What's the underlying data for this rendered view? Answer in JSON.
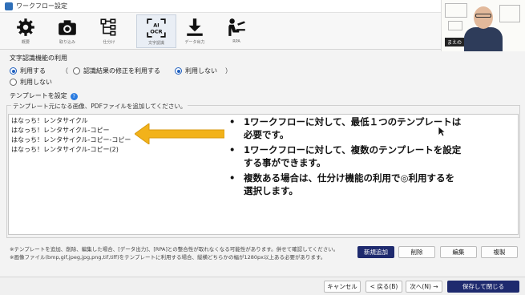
{
  "window": {
    "title": "ワークフロー設定"
  },
  "toolbar": {
    "items": [
      {
        "label": "概要",
        "icon": "gear-icon"
      },
      {
        "label": "取り込み",
        "icon": "camera-icon"
      },
      {
        "label": "仕分け",
        "icon": "sort-tree-icon"
      },
      {
        "label": "文字認識",
        "icon": "ai-ocr-icon",
        "active": true
      },
      {
        "label": "データ出力",
        "icon": "download-icon"
      },
      {
        "label": "RPA",
        "icon": "person-desk-icon"
      }
    ],
    "ocr_line1": "AI",
    "ocr_line2": "OCR"
  },
  "webcam": {
    "name_tag": "まえの"
  },
  "ocr_feature": {
    "title": "文字認識機能の利用",
    "use": "利用する",
    "paren_open": "（",
    "correction_use": "認識結果の修正を利用する",
    "correction_nouse": "利用しない",
    "paren_close": "）",
    "nouse": "利用しない"
  },
  "template": {
    "title": "テンプレートを設定",
    "help": "?",
    "group_caption": "テンプレート元になる画像、PDFファイルを追加してください。",
    "items": [
      "はなっち！レンタサイクル",
      "はなっち！レンタサイクル-コピー",
      "はなっち！レンタサイクル-コピー-コピー",
      "はなっち！レンタサイクル-コピー(2)"
    ]
  },
  "annotation": {
    "bullets": [
      "1ワークフローに対して、最低１つのテンプレートは必要です。",
      "1ワークフローに対して、複数のテンプレートを設定する事ができます。",
      "複数ある場合は、仕分け機能の利用で◎利用するを選択します。"
    ],
    "arrow_color": "#f2b21a"
  },
  "notes": [
    "※テンプレートを追加、削除、編集した場合、[データ出力]、[RPA]との整合性が取れなくなる可能性があります。併せて確認してください。",
    "※画像ファイル(bmp,gif,jpeg,jpg,png,tif,tiff)をテンプレートに利用する場合、縦横どちらかの幅が1280px以上ある必要があります。"
  ],
  "actions": {
    "add": "新規追加",
    "delete": "削除",
    "edit": "編集",
    "copy": "複製"
  },
  "footer": {
    "cancel": "キャンセル",
    "back": "< 戻る(B)",
    "next": "次へ(N) →",
    "save_close": "保存して閉じる"
  }
}
